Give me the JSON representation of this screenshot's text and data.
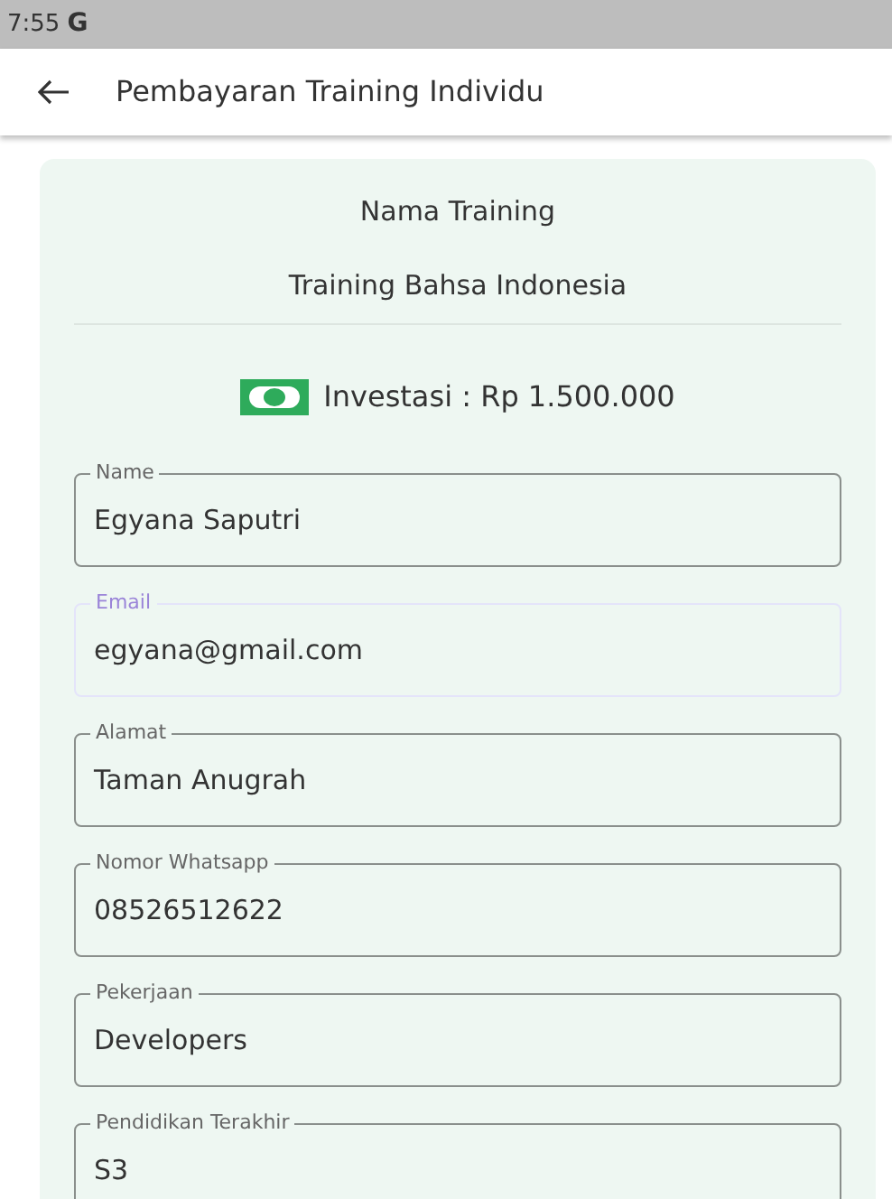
{
  "status_bar": {
    "time": "7:55",
    "app_letter": "G"
  },
  "app_bar": {
    "title": "Pembayaran Training Individu"
  },
  "card": {
    "heading": "Nama Training",
    "training_name": "Training Bahsa Indonesia",
    "investment": "Investasi : Rp 1.500.000"
  },
  "fields": [
    {
      "label": "Name",
      "value": "Egyana Saputri",
      "disabled": false
    },
    {
      "label": "Email",
      "value": "egyana@gmail.com",
      "disabled": true
    },
    {
      "label": "Alamat",
      "value": "Taman Anugrah",
      "disabled": false
    },
    {
      "label": "Nomor Whatsapp",
      "value": "08526512622",
      "disabled": false
    },
    {
      "label": "Pekerjaan",
      "value": "Developers",
      "disabled": false
    },
    {
      "label": "Pendidikan Terakhir",
      "value": "S3",
      "disabled": false
    }
  ]
}
